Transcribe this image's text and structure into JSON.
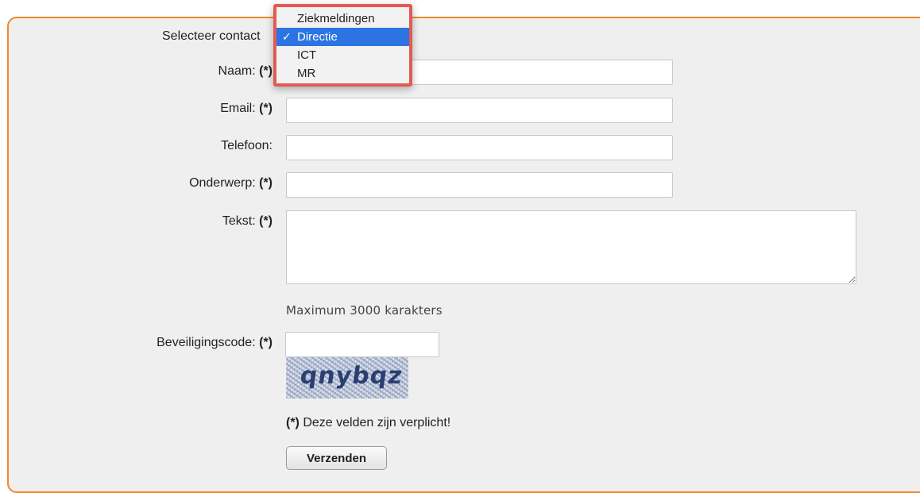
{
  "form": {
    "contact_label": "Selecteer contact",
    "required_marker": "(*)",
    "fields": {
      "naam": {
        "label": "Naam:",
        "value": ""
      },
      "email": {
        "label": "Email:",
        "value": ""
      },
      "telefoon": {
        "label": "Telefoon:",
        "value": ""
      },
      "onderwerp": {
        "label": "Onderwerp:",
        "value": ""
      },
      "tekst": {
        "label": "Tekst:",
        "value": ""
      }
    },
    "max_hint": "Maximum 3000 karakters",
    "security_label": "Beveiligingscode:",
    "security_value": "",
    "captcha_text": "qnybqz",
    "required_note": "Deze velden zijn verplicht!",
    "submit_label": "Verzenden"
  },
  "dropdown": {
    "selected": "Directie",
    "check_glyph": "✓",
    "options": [
      "Ziekmeldingen",
      "Directie",
      "ICT",
      "MR"
    ]
  },
  "colors": {
    "frame_border": "#f0882e",
    "highlight_border": "#e35a55",
    "selected_option": "#2b74e2"
  }
}
